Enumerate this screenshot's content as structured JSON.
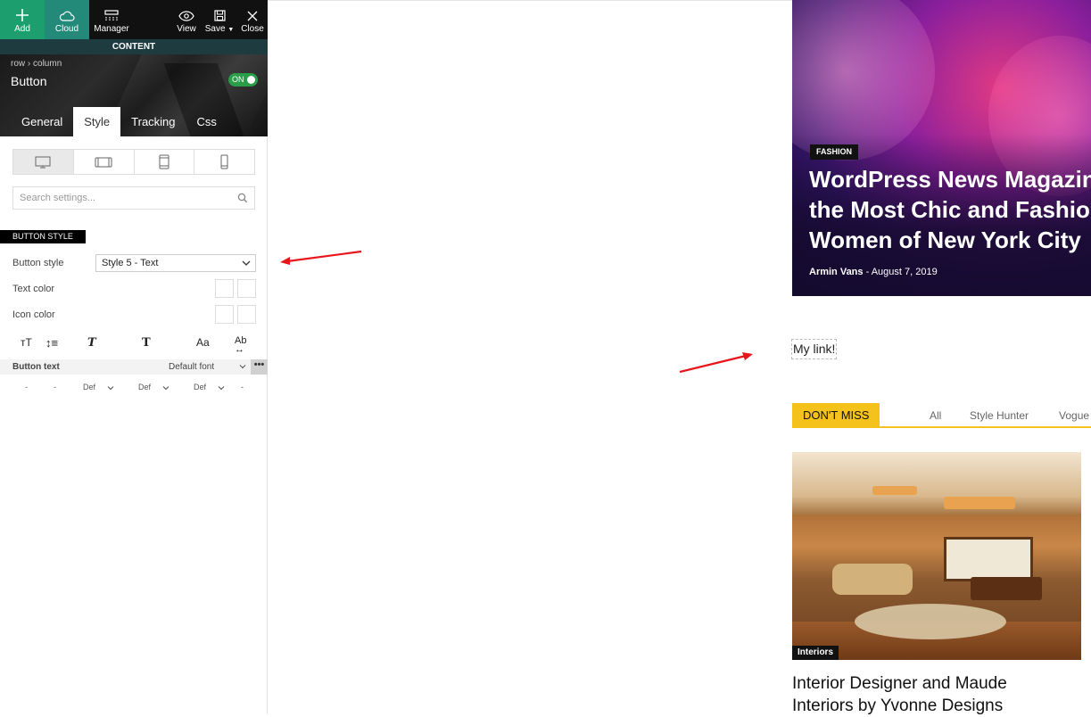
{
  "toolbar": {
    "add": "Add",
    "cloud": "Cloud",
    "manager": "Manager",
    "view": "View",
    "save": "Save",
    "close": "Close"
  },
  "panel": {
    "section": "CONTENT",
    "breadcrumb": [
      "row",
      "column"
    ],
    "element_title": "Button",
    "toggle": "ON",
    "tabs": [
      "General",
      "Style",
      "Tracking",
      "Css"
    ],
    "active_tab": "Style",
    "search_placeholder": "Search settings...",
    "group_label": "BUTTON STYLE",
    "button_style_label": "Button style",
    "button_style_value": "Style 5 - Text",
    "text_color_label": "Text color",
    "icon_color_label": "Icon color",
    "typography": {
      "icons": [
        "font-size-icon",
        "line-height-icon",
        "font-style-icon",
        "font-weight-icon",
        "text-transform-icon",
        "letter-spacing-icon"
      ],
      "row_label": "Button text",
      "font": "Default font",
      "more": "•••",
      "values": [
        "-",
        "-",
        "Def",
        "Def",
        "Def",
        "-"
      ]
    }
  },
  "preview": {
    "hero": {
      "category": "FASHION",
      "title_lines": [
        "WordPress News Magazin",
        "the Most Chic and Fashion",
        "Women of New York City"
      ],
      "author": "Armin Vans",
      "separator": "-",
      "date": "August 7, 2019"
    },
    "link_text": "My link!",
    "dont_miss": {
      "label": "DON'T MISS",
      "tabs": [
        "All",
        "Style Hunter",
        "Vogue"
      ]
    },
    "article": {
      "category": "Interiors",
      "title_lines": [
        "Interior Designer and Maude",
        "Interiors by Yvonne Designs"
      ]
    }
  },
  "colors": {
    "accent_green": "#1d9e6e",
    "content_bar": "#1e3b40",
    "toggle_on": "#2a9d49",
    "dont_miss_yellow": "#f5c21b",
    "arrow_red": "#e8151b"
  }
}
